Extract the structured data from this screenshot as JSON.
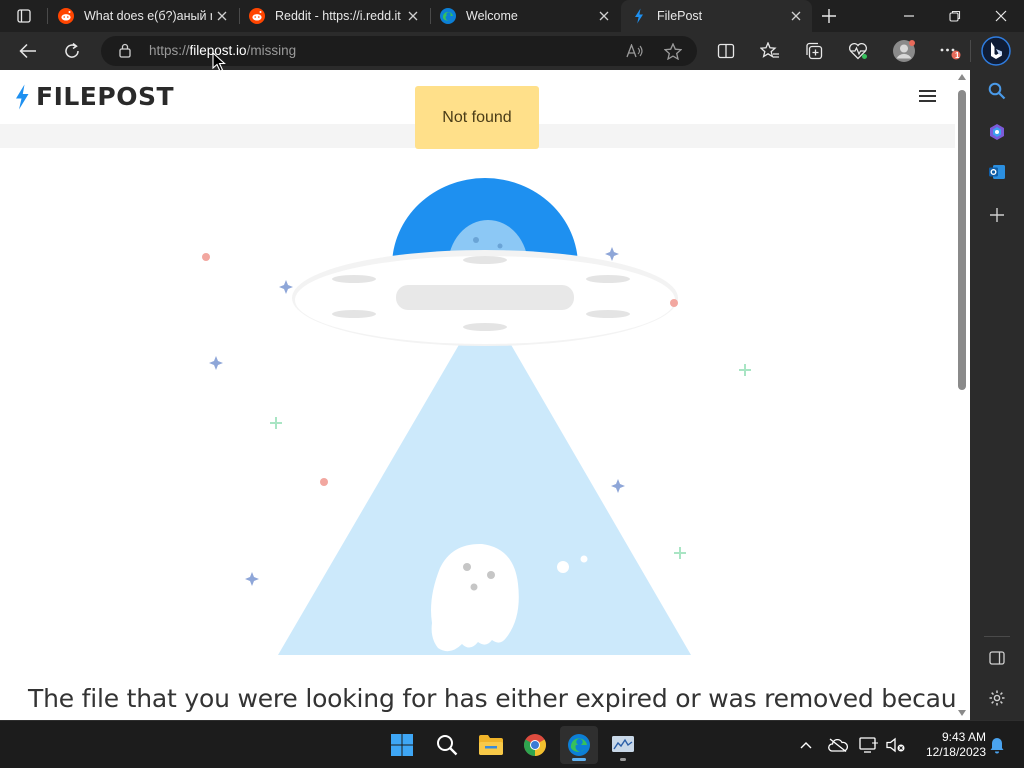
{
  "browser": {
    "tabs": [
      {
        "title": "What does e(б?)аный m",
        "favicon": "reddit-icon",
        "active": false
      },
      {
        "title": "Reddit - https://i.redd.it",
        "favicon": "reddit-icon",
        "active": false
      },
      {
        "title": "Welcome",
        "favicon": "edge-icon",
        "active": false
      },
      {
        "title": "FilePost",
        "favicon": "filepost-icon",
        "active": true
      }
    ],
    "address": {
      "scheme": "https://",
      "host": "filepost.io",
      "path": "/missing"
    },
    "notification_badge": "1"
  },
  "site": {
    "logo_text": "FILEPOST",
    "toast": "Not found",
    "message": "The file that you were looking for has either expired or was removed because of"
  },
  "illustration": {
    "subject": "ufo-abducting-ghost",
    "colors": {
      "dome": "#1e90f0",
      "beam": "#cce9fb",
      "saucer": "#f2f2f2",
      "star_blue": "#8ea6d8",
      "star_green": "#a9e5c4",
      "dot_red": "#f2a7a0"
    }
  },
  "taskbar": {
    "apps": [
      "windows-start-icon",
      "search-icon",
      "file-explorer-icon",
      "chrome-icon",
      "edge-icon",
      "monitor-app-icon"
    ],
    "clock_time": "9:43 AM",
    "clock_date": "12/18/2023"
  },
  "colors": {
    "accent": "#1e90f0",
    "toast_bg": "#ffe08a",
    "chrome_dark": "#202020"
  }
}
